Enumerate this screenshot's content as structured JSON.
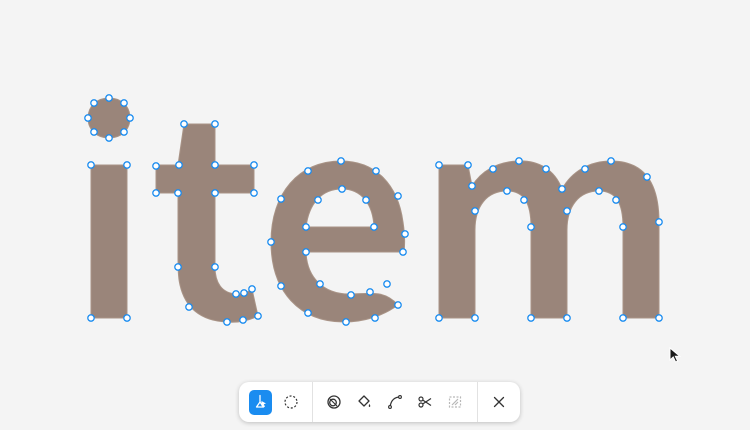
{
  "canvas": {
    "text": "item",
    "glyph_fill": "#9a857a",
    "anchor_color": "#1a8cf0"
  },
  "toolbar": {
    "accent": "#1a8cf0",
    "tools": [
      {
        "name": "direct-select-tool",
        "icon": "pen-select-icon",
        "active": true
      },
      {
        "name": "lasso-select-tool",
        "icon": "dashed-circle-icon",
        "active": false
      },
      {
        "name": "boolean-tool",
        "icon": "overlap-circles-icon",
        "active": false
      },
      {
        "name": "fill-tool",
        "icon": "paint-bucket-icon",
        "active": false
      },
      {
        "name": "curve-tool",
        "icon": "bezier-curve-icon",
        "active": false
      },
      {
        "name": "cut-tool",
        "icon": "scissors-icon",
        "active": false
      },
      {
        "name": "outline-tool",
        "icon": "outline-disabled-icon",
        "active": false,
        "disabled": true
      },
      {
        "name": "close-tool",
        "icon": "close-icon",
        "active": false
      }
    ]
  },
  "cursor": {
    "icon": "arrow-cursor-icon"
  }
}
